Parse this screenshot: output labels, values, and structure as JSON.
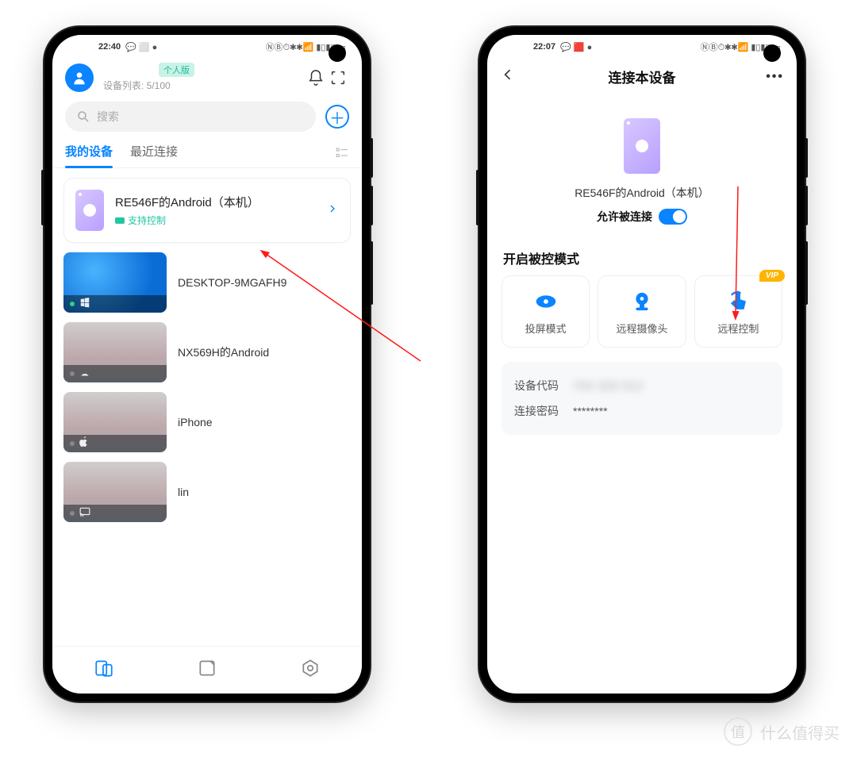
{
  "left": {
    "statusbar": {
      "time": "22:40"
    },
    "plan_badge": "个人版",
    "device_count": "设备列表: 5/100",
    "search_placeholder": "搜索",
    "tabs": {
      "mine": "我的设备",
      "recent": "最近连接"
    },
    "main_device": {
      "name": "RE546F的Android（本机）",
      "sub": "支持控制"
    },
    "others": [
      {
        "name": "DESKTOP-9MGAFH9",
        "os": "windows",
        "online": true
      },
      {
        "name": "NX569H的Android",
        "os": "android",
        "online": false
      },
      {
        "name": "iPhone",
        "os": "apple",
        "online": false
      },
      {
        "name": "lin",
        "os": "cast",
        "online": false
      }
    ]
  },
  "right": {
    "statusbar": {
      "time": "22:07"
    },
    "title": "连接本设备",
    "device_name": "RE546F的Android（本机）",
    "allow_label": "允许被连接",
    "section": "开启被控模式",
    "modes": {
      "cast": "投屏模式",
      "camera": "远程摄像头",
      "control": "远程控制",
      "vip": "VIP"
    },
    "code_label": "设备代码",
    "code_value": "754 328 912",
    "pass_label": "连接密码",
    "pass_value": "********"
  },
  "watermark": "什么值得买"
}
